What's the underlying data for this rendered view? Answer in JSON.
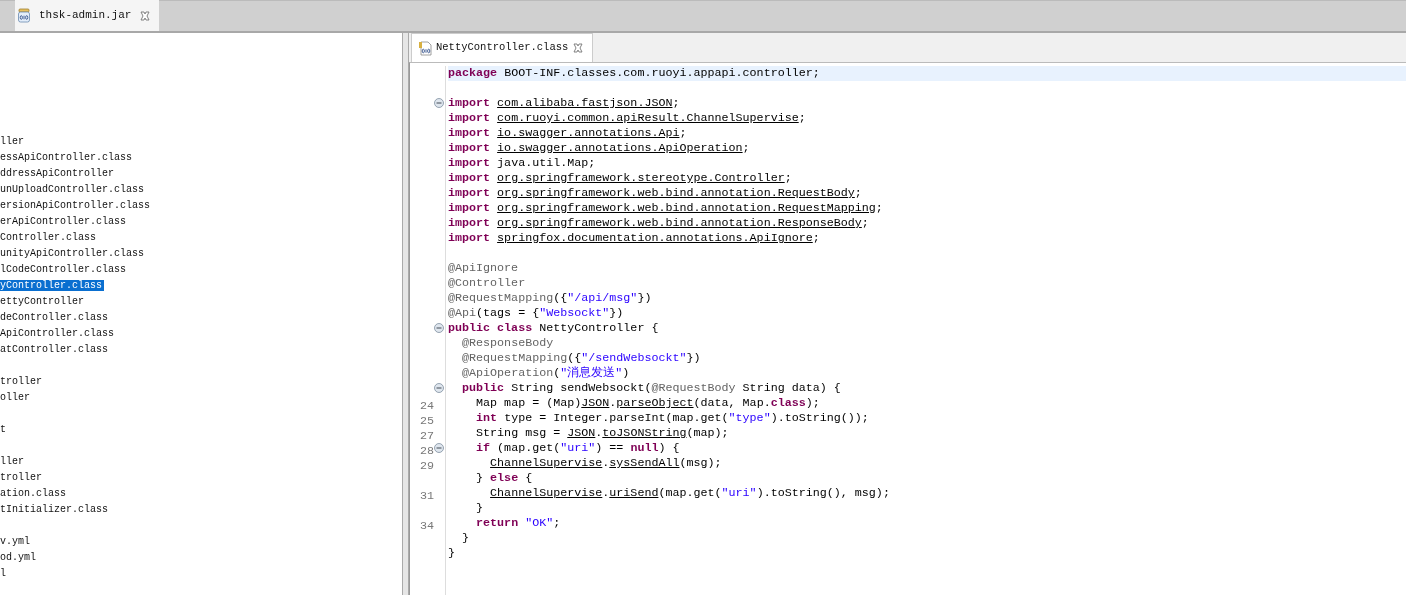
{
  "top_tabs": [
    {
      "label": "thsk-admin.jar",
      "selected": true
    }
  ],
  "tree": {
    "groups": [
      [
        {
          "text": "ller",
          "selected": false
        },
        {
          "text": "essApiController.class",
          "selected": false
        },
        {
          "text": "ddressApiController",
          "selected": false
        },
        {
          "text": "unUploadController.class",
          "selected": false
        },
        {
          "text": "ersionApiController.class",
          "selected": false
        },
        {
          "text": "erApiController.class",
          "selected": false
        },
        {
          "text": "Controller.class",
          "selected": false
        },
        {
          "text": "unityApiController.class",
          "selected": false
        },
        {
          "text": "lCodeController.class",
          "selected": false
        },
        {
          "text": "yController.class",
          "selected": true
        },
        {
          "text": "ettyController",
          "selected": false
        },
        {
          "text": "deController.class",
          "selected": false
        },
        {
          "text": "ApiController.class",
          "selected": false
        },
        {
          "text": "atController.class",
          "selected": false
        }
      ],
      [
        {
          "text": "troller",
          "selected": false
        },
        {
          "text": "oller",
          "selected": false
        }
      ],
      [
        {
          "text": "t",
          "selected": false
        }
      ],
      [
        {
          "text": "ller",
          "selected": false
        },
        {
          "text": "troller",
          "selected": false
        },
        {
          "text": "ation.class",
          "selected": false
        },
        {
          "text": "tInitializer.class",
          "selected": false
        }
      ],
      [
        {
          "text": "v.yml",
          "selected": false
        },
        {
          "text": "od.yml",
          "selected": false
        },
        {
          "text": "l",
          "selected": false
        }
      ]
    ]
  },
  "editor": {
    "tab": {
      "label": "NettyController.class",
      "selected": true
    },
    "blocks": [
      [
        {
          "current": true,
          "collapsible": false,
          "tokens": [
            {
              "kind": "kw",
              "text": "package"
            },
            {
              "kind": "plain",
              "text": " BOOT-INF.classes.com.ruoyi.appapi.controller;"
            }
          ]
        }
      ],
      [
        {
          "current": false,
          "collapsible": true,
          "tokens": [
            {
              "kind": "kw",
              "text": "import "
            },
            {
              "kind": "link",
              "text": "com.alibaba.fastjson.JSON"
            },
            {
              "kind": "plain",
              "text": ";"
            }
          ]
        },
        {
          "current": false,
          "collapsible": false,
          "tokens": [
            {
              "kind": "kw",
              "text": "import "
            },
            {
              "kind": "link",
              "text": "com.ruoyi.common.apiResult.ChannelSupervise"
            },
            {
              "kind": "plain",
              "text": ";"
            }
          ]
        },
        {
          "current": false,
          "collapsible": false,
          "tokens": [
            {
              "kind": "kw",
              "text": "import "
            },
            {
              "kind": "link",
              "text": "io.swagger.annotations.Api"
            },
            {
              "kind": "plain",
              "text": ";"
            }
          ]
        },
        {
          "current": false,
          "collapsible": false,
          "tokens": [
            {
              "kind": "kw",
              "text": "import "
            },
            {
              "kind": "link",
              "text": "io.swagger.annotations.ApiOperation"
            },
            {
              "kind": "plain",
              "text": ";"
            }
          ]
        },
        {
          "current": false,
          "collapsible": false,
          "tokens": [
            {
              "kind": "kw",
              "text": "import"
            },
            {
              "kind": "plain",
              "text": " java.util.Map;"
            }
          ]
        },
        {
          "current": false,
          "collapsible": false,
          "tokens": [
            {
              "kind": "kw",
              "text": "import "
            },
            {
              "kind": "link",
              "text": "org.springframework.stereotype.Controller"
            },
            {
              "kind": "plain",
              "text": ";"
            }
          ]
        },
        {
          "current": false,
          "collapsible": false,
          "tokens": [
            {
              "kind": "kw",
              "text": "import "
            },
            {
              "kind": "link",
              "text": "org.springframework.web.bind.annotation.RequestBody"
            },
            {
              "kind": "plain",
              "text": ";"
            }
          ]
        },
        {
          "current": false,
          "collapsible": false,
          "tokens": [
            {
              "kind": "kw",
              "text": "import "
            },
            {
              "kind": "link",
              "text": "org.springframework.web.bind.annotation.RequestMapping"
            },
            {
              "kind": "plain",
              "text": ";"
            }
          ]
        },
        {
          "current": false,
          "collapsible": false,
          "tokens": [
            {
              "kind": "kw",
              "text": "import "
            },
            {
              "kind": "link",
              "text": "org.springframework.web.bind.annotation.ResponseBody"
            },
            {
              "kind": "plain",
              "text": ";"
            }
          ]
        },
        {
          "current": false,
          "collapsible": false,
          "tokens": [
            {
              "kind": "kw",
              "text": "import "
            },
            {
              "kind": "link",
              "text": "springfox.documentation.annotations.ApiIgnore"
            },
            {
              "kind": "plain",
              "text": ";"
            }
          ]
        }
      ],
      [
        {
          "current": false,
          "collapsible": false,
          "tokens": [
            {
              "kind": "ann",
              "text": "@ApiIgnore"
            }
          ]
        },
        {
          "current": false,
          "collapsible": false,
          "tokens": [
            {
              "kind": "ann",
              "text": "@Controller"
            }
          ]
        },
        {
          "current": false,
          "collapsible": false,
          "tokens": [
            {
              "kind": "ann",
              "text": "@RequestMapping"
            },
            {
              "kind": "plain",
              "text": "({"
            },
            {
              "kind": "str",
              "text": "\"/api/msg\""
            },
            {
              "kind": "plain",
              "text": "})"
            }
          ]
        },
        {
          "current": false,
          "collapsible": false,
          "tokens": [
            {
              "kind": "ann",
              "text": "@Api"
            },
            {
              "kind": "plain",
              "text": "(tags = {"
            },
            {
              "kind": "str",
              "text": "\"Websockt\""
            },
            {
              "kind": "plain",
              "text": "})"
            }
          ]
        },
        {
          "current": false,
          "collapsible": true,
          "tokens": [
            {
              "kind": "kw",
              "text": "public class"
            },
            {
              "kind": "plain",
              "text": " NettyController {"
            }
          ]
        },
        {
          "current": false,
          "collapsible": false,
          "tokens": [
            {
              "kind": "ann",
              "text": "  @ResponseBody"
            }
          ]
        },
        {
          "current": false,
          "collapsible": false,
          "tokens": [
            {
              "kind": "ann",
              "text": "  @RequestMapping"
            },
            {
              "kind": "plain",
              "text": "({"
            },
            {
              "kind": "str",
              "text": "\"/sendWebsockt\""
            },
            {
              "kind": "plain",
              "text": "})"
            }
          ]
        },
        {
          "current": false,
          "collapsible": false,
          "tokens": [
            {
              "kind": "ann",
              "text": "  @ApiOperation"
            },
            {
              "kind": "plain",
              "text": "("
            },
            {
              "kind": "str",
              "text": "\"消息发送\""
            },
            {
              "kind": "plain",
              "text": ")"
            }
          ]
        },
        {
          "current": false,
          "collapsible": true,
          "tokens": [
            {
              "kind": "kw",
              "text": "  public"
            },
            {
              "kind": "plain",
              "text": " String sendWebsockt("
            },
            {
              "kind": "ann",
              "text": "@RequestBody"
            },
            {
              "kind": "plain",
              "text": " String data) {"
            }
          ]
        },
        {
          "number": "24",
          "current": false,
          "collapsible": false,
          "tokens": [
            {
              "kind": "plain",
              "text": "    Map map = (Map)"
            },
            {
              "kind": "link",
              "text": "JSON"
            },
            {
              "kind": "plain",
              "text": "."
            },
            {
              "kind": "link",
              "text": "parseObject"
            },
            {
              "kind": "plain",
              "text": "(data, Map."
            },
            {
              "kind": "kw",
              "text": "class"
            },
            {
              "kind": "plain",
              "text": ");"
            }
          ]
        },
        {
          "number": "25",
          "current": false,
          "collapsible": false,
          "tokens": [
            {
              "kind": "kw",
              "text": "    int"
            },
            {
              "kind": "plain",
              "text": " type = Integer.parseInt(map.get("
            },
            {
              "kind": "str",
              "text": "\"type\""
            },
            {
              "kind": "plain",
              "text": ").toString());"
            }
          ]
        },
        {
          "number": "27",
          "current": false,
          "collapsible": false,
          "tokens": [
            {
              "kind": "plain",
              "text": "    String msg = "
            },
            {
              "kind": "link",
              "text": "JSON"
            },
            {
              "kind": "plain",
              "text": "."
            },
            {
              "kind": "link",
              "text": "toJSONString"
            },
            {
              "kind": "plain",
              "text": "(map);"
            }
          ]
        },
        {
          "number": "28",
          "current": false,
          "collapsible": true,
          "tokens": [
            {
              "kind": "kw",
              "text": "    if"
            },
            {
              "kind": "plain",
              "text": " (map.get("
            },
            {
              "kind": "str",
              "text": "\"uri\""
            },
            {
              "kind": "plain",
              "text": ") == "
            },
            {
              "kind": "kw",
              "text": "null"
            },
            {
              "kind": "plain",
              "text": ") {"
            }
          ]
        },
        {
          "number": "29",
          "current": false,
          "collapsible": false,
          "tokens": [
            {
              "kind": "link",
              "text": "      ChannelSupervise"
            },
            {
              "kind": "plain",
              "text": "."
            },
            {
              "kind": "link",
              "text": "sysSendAll"
            },
            {
              "kind": "plain",
              "text": "(msg);"
            }
          ]
        },
        {
          "current": false,
          "collapsible": false,
          "tokens": [
            {
              "kind": "plain",
              "text": "    } "
            },
            {
              "kind": "kw",
              "text": "else"
            },
            {
              "kind": "plain",
              "text": " {"
            }
          ]
        },
        {
          "number": "31",
          "current": false,
          "collapsible": false,
          "tokens": [
            {
              "kind": "link",
              "text": "      ChannelSupervise"
            },
            {
              "kind": "plain",
              "text": "."
            },
            {
              "kind": "link",
              "text": "uriSend"
            },
            {
              "kind": "plain",
              "text": "(map.get("
            },
            {
              "kind": "str",
              "text": "\"uri\""
            },
            {
              "kind": "plain",
              "text": ").toString(), msg);"
            }
          ]
        },
        {
          "current": false,
          "collapsible": false,
          "tokens": [
            {
              "kind": "plain",
              "text": "    }"
            }
          ]
        },
        {
          "number": "34",
          "current": false,
          "collapsible": false,
          "tokens": [
            {
              "kind": "kw",
              "text": "    return"
            },
            {
              "kind": "str",
              "text": " \"OK\""
            },
            {
              "kind": "plain",
              "text": ";"
            }
          ]
        },
        {
          "current": false,
          "collapsible": false,
          "tokens": [
            {
              "kind": "plain",
              "text": "  }"
            }
          ]
        },
        {
          "current": false,
          "collapsible": false,
          "tokens": [
            {
              "kind": "plain",
              "text": "}"
            }
          ]
        }
      ]
    ]
  }
}
